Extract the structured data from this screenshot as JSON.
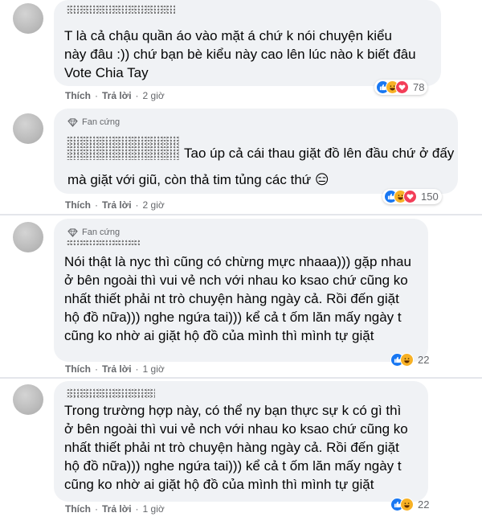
{
  "colors": {
    "like": "#1877f2",
    "haha": "#f7b125",
    "love": "#f33e58",
    "bubble": "#f0f2f5",
    "meta": "#65676b"
  },
  "comments": [
    {
      "fan_badge": "",
      "text": "T là cả chậu quần áo vào mặt á chứ k nói chuyện kiểu\nnày đâu :)) chứ bạn bè kiểu này cao lên lúc nào k biết đâu\nVote Chia Tay",
      "like_label": "Thích",
      "reply_label": "Trả lời",
      "time": "2 giờ",
      "reactions": [
        "like-icon",
        "haha-icon",
        "love-icon"
      ],
      "reaction_count": "78"
    },
    {
      "fan_badge": "Fan cứng",
      "text_first_line": "Tao úp cả cái thau giặt đồ lên đầu chứ ở đấy",
      "text": "mà giặt với giũ, còn thả tim tủng các thứ 😑",
      "like_label": "Thích",
      "reply_label": "Trả lời",
      "time": "2 giờ",
      "reactions": [
        "like-icon",
        "haha-icon",
        "love-icon"
      ],
      "reaction_count": "150"
    },
    {
      "fan_badge": "Fan cứng",
      "text": "Nói thật là nyc thì cũng có chừng mực nhaaa))) gặp nhau\nở bên ngoài thì vui vẻ nch với nhau ko ksao chứ cũng ko\nnhất thiết phải nt trò chuyện hàng ngày cả. Rồi đến giặt\nhộ đồ nữa))) nghe ngứa tai))) kể cả t ốm lăn mấy ngày t\ncũng ko nhờ ai giặt hộ đồ của mình thì mình tự giặt",
      "like_label": "Thích",
      "reply_label": "Trả lời",
      "time": "1 giờ",
      "reactions": [
        "like-icon",
        "haha-icon"
      ],
      "reaction_count": "22"
    },
    {
      "fan_badge": "",
      "text": "Trong trường hợp này, có thể ny bạn thực sự k có gì thì\nở bên ngoài thì vui vẻ nch với nhau ko ksao chứ cũng ko\nnhất thiết phải nt trò chuyện hàng ngày cả. Rồi đến giặt\nhộ đồ nữa))) nghe ngứa tai))) kể cả t ốm lăn mấy ngày t\ncũng ko nhờ ai giặt hộ đồ của mình thì mình tự giặt",
      "like_label": "Thích",
      "reply_label": "Trả lời",
      "time": "1 giờ",
      "reactions": [
        "like-icon",
        "haha-icon"
      ],
      "reaction_count": "22"
    }
  ]
}
